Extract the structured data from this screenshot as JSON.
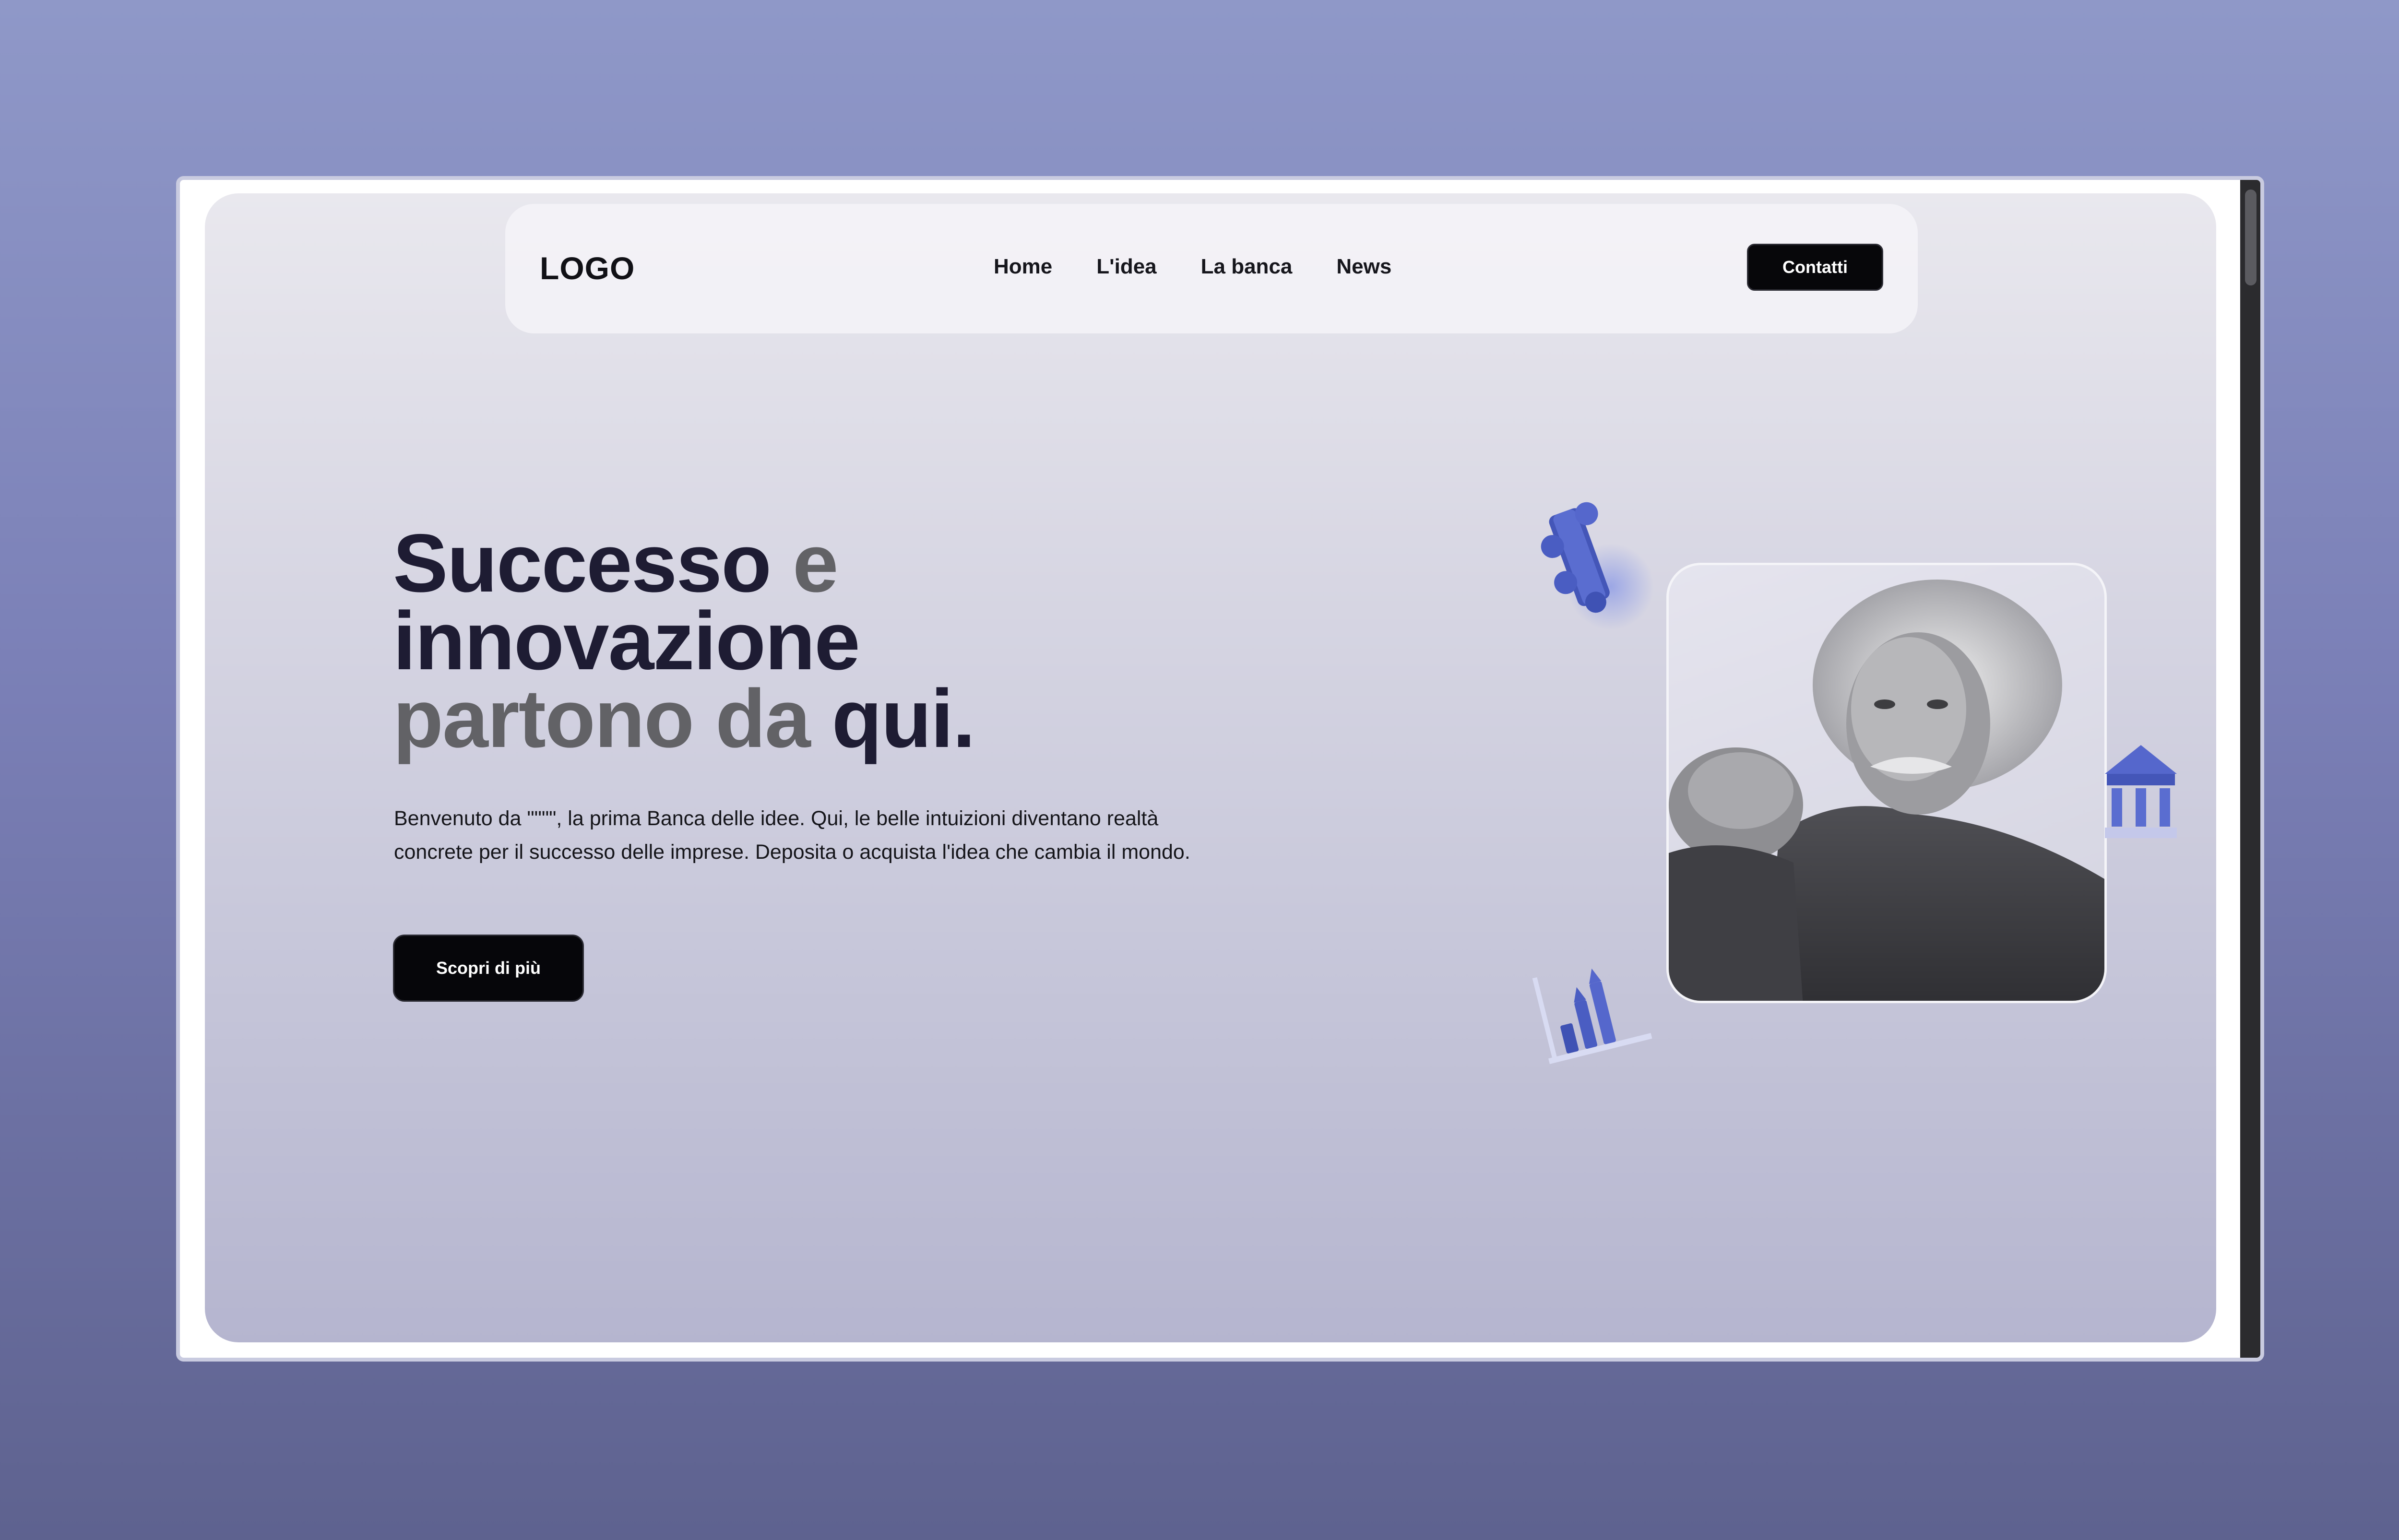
{
  "nav": {
    "logo": "LOGO",
    "links": [
      "Home",
      "L'idea",
      "La banca",
      "News"
    ],
    "contact_label": "Contatti"
  },
  "hero": {
    "title_part1": "Successo ",
    "title_part2": "e",
    "title_part3": "innovazione",
    "title_part4": "partono da ",
    "title_part5": "qui.",
    "description": "Benvenuto da \"\"\"\", la prima Banca delle idee. Qui, le belle intuizioni diventano realtà concrete per il successo delle imprese. Deposita o acquista l'idea che cambia il mondo.",
    "cta_label": "Scopri di più"
  },
  "colors": {
    "accent": "#4a5dc2",
    "button_bg": "#07070a",
    "heading": "#1e1c33",
    "heading_muted": "#626266"
  },
  "icons": [
    "puzzle-icon",
    "bank-icon",
    "growth-chart-icon"
  ]
}
